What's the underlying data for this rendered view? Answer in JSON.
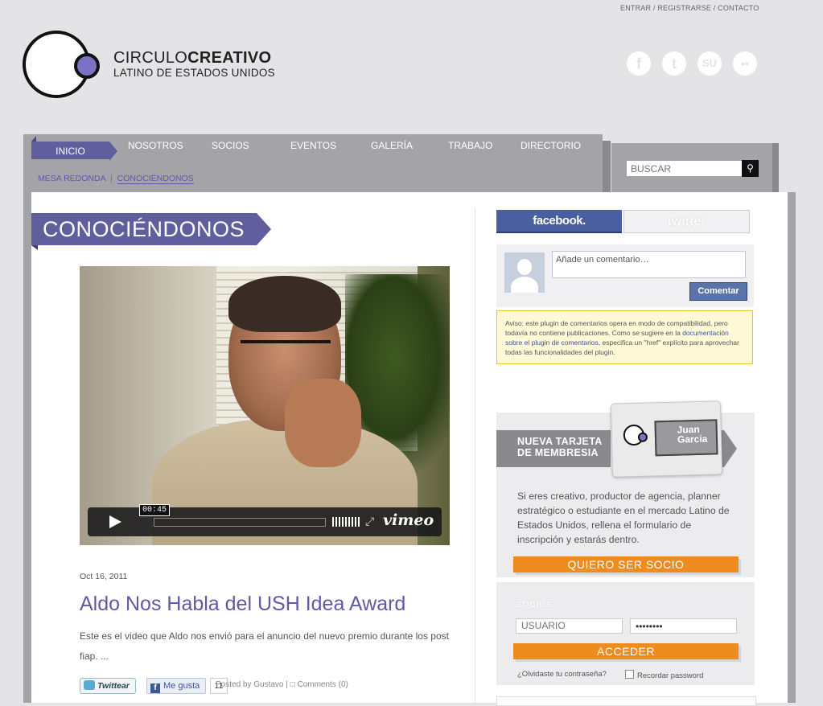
{
  "top_links": {
    "entrar": "ENTRAR",
    "registrarse": "REGISTRARSE",
    "contacto": "CONTACTO",
    "sep": " / "
  },
  "logo": {
    "line1_light": "CIRCULO",
    "line1_bold": "CREATIVO",
    "line2": "LATINO DE ESTADOS UNIDOS"
  },
  "social": [
    {
      "icon": "facebook-icon",
      "glyph": "f"
    },
    {
      "icon": "twitter-icon",
      "glyph": "t"
    },
    {
      "icon": "stumbleupon-icon",
      "glyph": "SU"
    },
    {
      "icon": "flickr-icon",
      "glyph": "••"
    }
  ],
  "nav": {
    "active": "INICIO",
    "items": [
      "NOSOTROS",
      "SOCIOS",
      "EVENTOS",
      "GALERÍA",
      "TRABAJO",
      "DIRECTORIO"
    ],
    "sub_items": [
      "MESA REDONDA",
      "CONOCIÉNDONOS"
    ],
    "sub_sep": "|"
  },
  "search": {
    "placeholder": "BUSCAR"
  },
  "page_title": "CONOCIÉNDONOS",
  "video": {
    "time": "00:45",
    "provider": "vimeo"
  },
  "post": {
    "date": "Oct 16, 2011",
    "title": "Aldo Nos Habla del USH Idea Award",
    "excerpt": "Este es el video que Aldo nos envió para el anuncio del nuevo premio durante los post fiap. ...",
    "tweet_label": "Twittear",
    "like_label": "Me gusta",
    "like_count": "11",
    "posted_by": "Posted by Gustavo",
    "meta_sep": " | ",
    "comments": "Comments (0)"
  },
  "comments_widget": {
    "tab_facebook": "facebook.",
    "tab_twitter": "twitter",
    "input_placeholder": "Añade un comentario…",
    "button": "Comentar",
    "notice_pre": "Aviso: este plugin de comentarios opera en modo de compatibilidad, pero todavía no contiene publicaciones. Como se sugiere en la ",
    "notice_link": "documentación sobre el plugin de comentarios",
    "notice_post": ", especifica un \"href\" explícito para aprovechar todas las funcionalidades del plugin."
  },
  "membership": {
    "title_line1": "NUEVA TARJETA",
    "title_line2": "DE MEMBRESIA",
    "card_name_line1": "Juan",
    "card_name_line2": "Garcia",
    "text": "Si eres creativo, productor de agencia, planner estratégico o estudiante en el mercado Latino de Estados Unidos, rellena el formulario de inscripción y estarás dentro.",
    "button": "QUIERO SER SOCIO"
  },
  "login": {
    "label": "SOCIOS",
    "user_placeholder": "USUARIO",
    "password_value": "••••••••",
    "button": "ACCEDER",
    "forgot": "¿Olvidaste tu contraseña?",
    "remember": "Recordar password"
  },
  "colors": {
    "accent": "#615e9e",
    "link": "#5d5aa8",
    "orange": "#ee8c1d",
    "facebook": "#4a5fa0"
  }
}
